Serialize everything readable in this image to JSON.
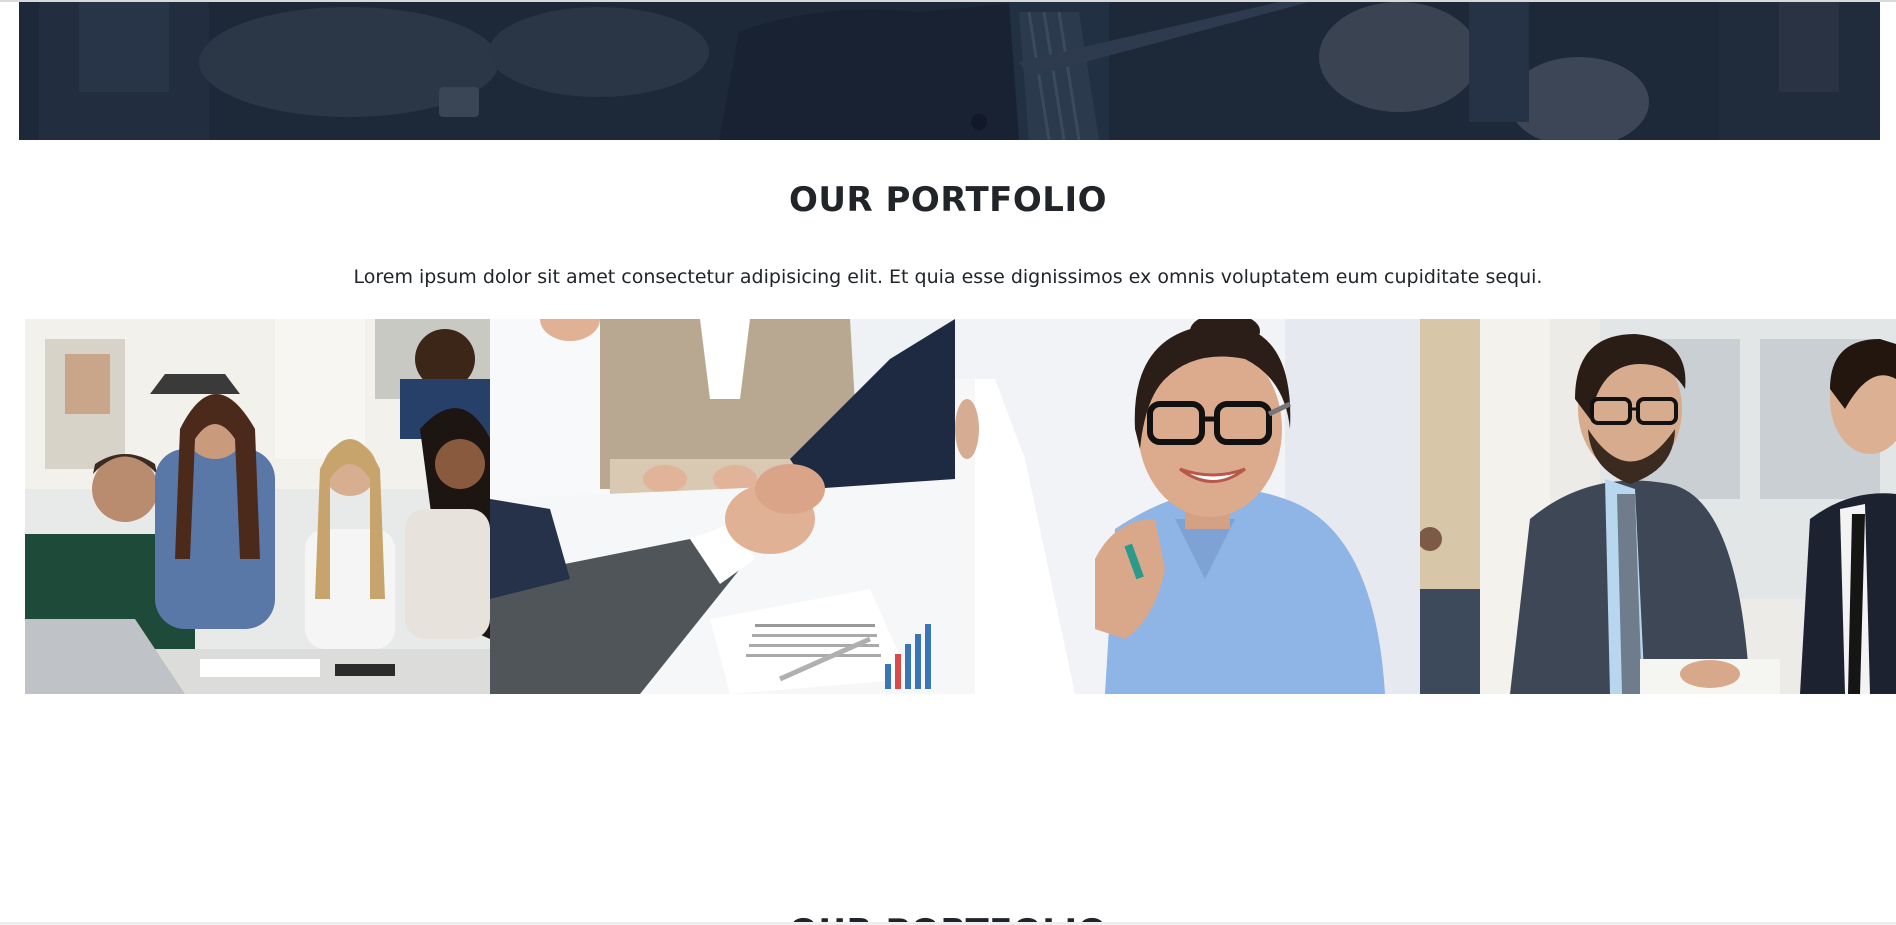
{
  "hero": {
    "overlay_color": "#1c2738",
    "image": "business-meeting-banner"
  },
  "portfolio": {
    "title": "OUR PORTFOLIO",
    "description": "Lorem ipsum dolor sit amet consectetur adipisicing elit. Et quia esse dignissimos ex omnis voluptatem eum cupiditate sequi.",
    "items": [
      {
        "image": "team-working-at-table-photo"
      },
      {
        "image": "business-handshake-contract-photo"
      },
      {
        "image": "smiling-woman-with-glasses-photo"
      },
      {
        "image": "businessmen-reviewing-documents-photo"
      }
    ]
  },
  "next_section": {
    "title": "OUR PORTFOLIO"
  }
}
